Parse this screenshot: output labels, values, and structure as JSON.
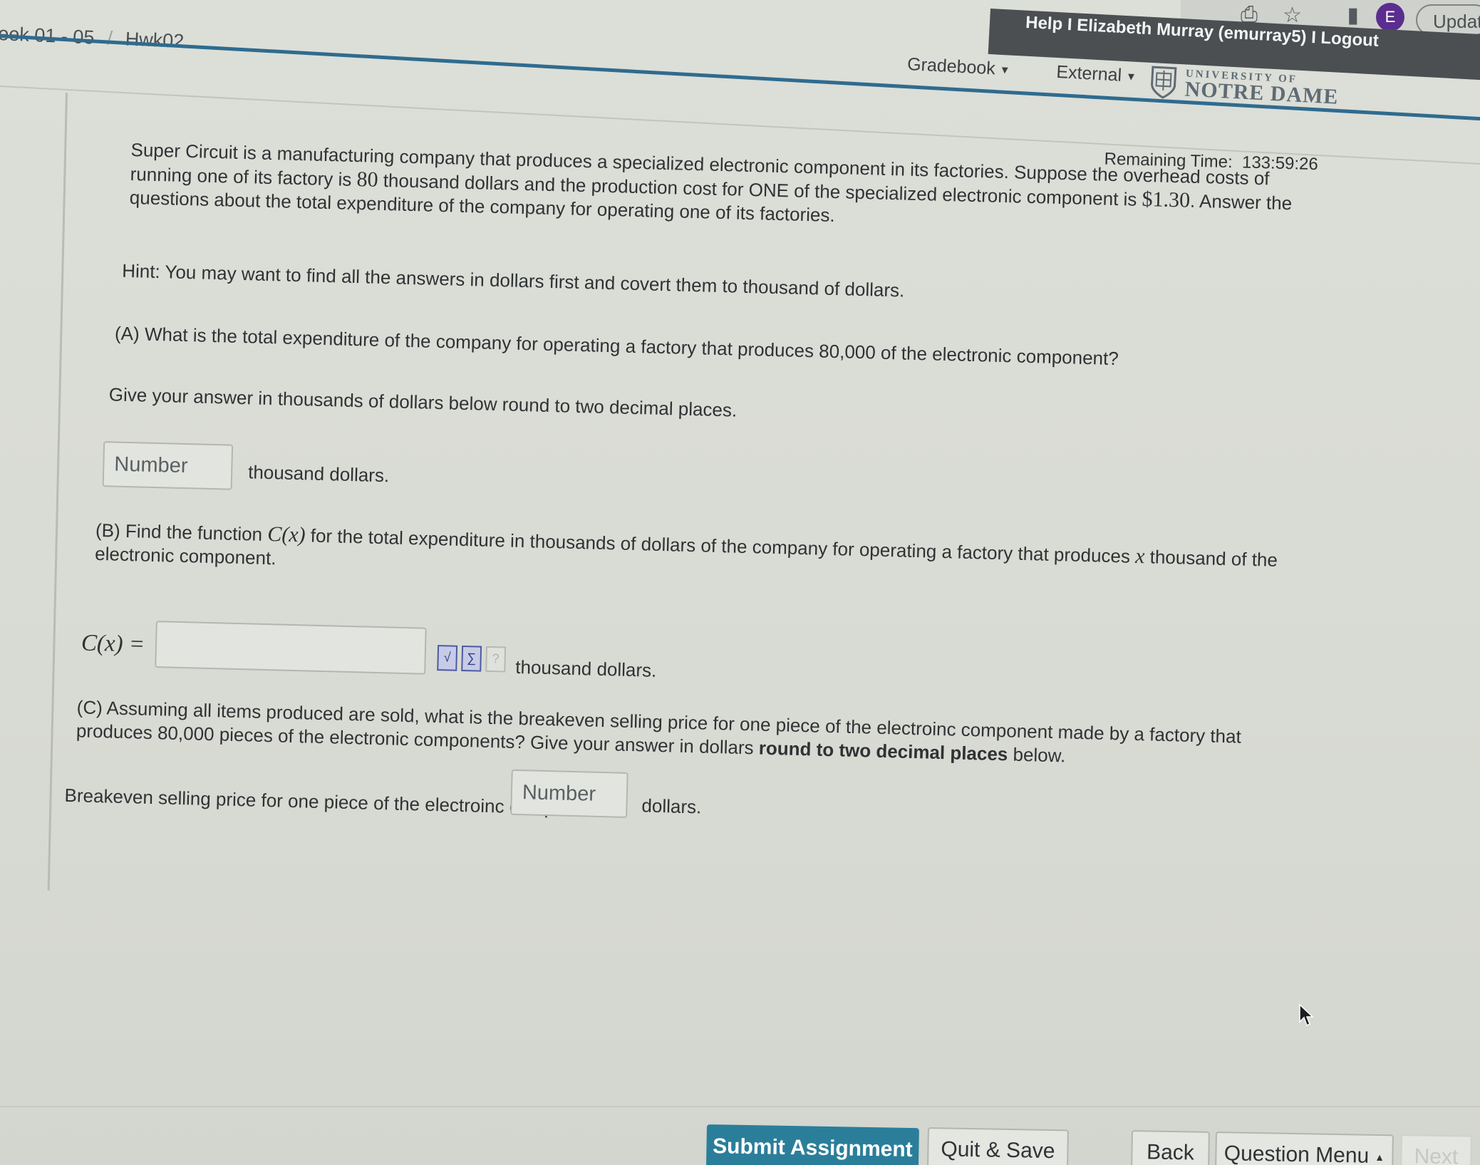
{
  "browser": {
    "avatar_letter": "E",
    "update_label": "Updat",
    "avatar_color": "#5b2d8f"
  },
  "header": {
    "user_links": {
      "help": "Help",
      "separator": " I ",
      "user": "Elizabeth Murray (emurray5)",
      "logout": "Logout"
    },
    "breadcrumb": {
      "week": "eek 01 - 05",
      "separator": "/",
      "assignment": "Hwk02"
    },
    "nav": {
      "gradebook": "Gradebook",
      "external": "External"
    },
    "logo": {
      "line1": "UNIVERSITY OF",
      "line2": "NOTRE DAME"
    }
  },
  "timer": {
    "label": "Remaining Time:",
    "value": "133:59:26"
  },
  "question": {
    "intro_1": "Super Circuit is a manufacturing company that produces a specialized electronic component in its factories. Suppose the overhead costs of running one of its factory is ",
    "overhead_value": "80",
    "intro_2": " thousand dollars and the production cost for ONE of the specialized electronic component is ",
    "unit_cost": "$1.30",
    "intro_3": ". Answer the questions about the total expenditure of the company for operating one of its factories.",
    "hint": "Hint: You may want to find all the answers in dollars first and covert them to thousand of dollars.",
    "part_a": {
      "text": "(A) What is the total expenditure of the company for operating a factory that produces 80,000 of the electronic component?",
      "instruction": "Give your answer in thousands of dollars below round to two decimal places.",
      "placeholder": "Number",
      "unit": "thousand dollars."
    },
    "part_b": {
      "text_1": "(B) Find the function ",
      "func": "C(x)",
      "text_2": " for the total expenditure in thousands of dollars of the company for operating a factory that produces ",
      "var": "x",
      "text_3": " thousand of the electronic component.",
      "label": "C(x) =",
      "value": "",
      "unit": "thousand dollars."
    },
    "part_c": {
      "text_1": "(C) Assuming all items produced are sold, what is the breakeven selling price for one piece of the electroinc component made by a factory that produces 80,000 pieces of the electronic components? Give your answer in dollars ",
      "bold": "round to two decimal places",
      "text_2": " below.",
      "label": "Breakeven selling price for one piece of the electroinc component =",
      "placeholder": "Number",
      "unit": "dollars."
    }
  },
  "footer": {
    "submit": "Submit Assignment",
    "quit_save": "Quit & Save",
    "back": "Back",
    "question_menu": "Question Menu",
    "next": "Next",
    "submit_color": "#2b7e9a"
  }
}
